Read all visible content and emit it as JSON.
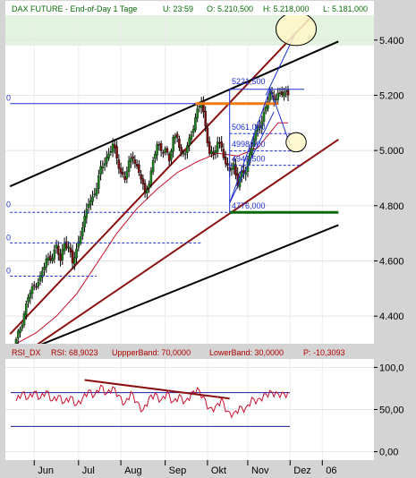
{
  "colors": {
    "frame": "#c8c8c8",
    "pane_bg": "#ffffff",
    "band": "#e2f4df",
    "candle_up": "#1a7f1a",
    "candle_down": "#7a0e0e",
    "wick": "#000000",
    "channel_red": "#8b1010",
    "channel_black": "#000000",
    "ma_red": "#c8102e",
    "blue": "#1f2fd0",
    "orange": "#f07a10",
    "green": "#0a6b0a",
    "ellipse_fill": "#fff7c8",
    "rsi_line": "#c8102e",
    "rsi_band": "#1a1aa0",
    "header_text": "#0a6b0a",
    "rsi_text": "#b00000"
  },
  "header": {
    "symbol": "DAX FUTURE - End-of-Day 1 Tage",
    "u": "U: 23:59",
    "o": "O: 5.210,500",
    "h": "H: 5.218,000",
    "l": "L: 5.181,000"
  },
  "rsi_header": {
    "name": "RSI_DX",
    "rsi": "RSI: 68,9023",
    "upper": "UppperBand: 70,0000",
    "lower": "LowerBand: 30,0000",
    "p": "P: -10,3093"
  },
  "left_marks": [
    {
      "value": 5170,
      "text": "0"
    },
    {
      "value": 4785,
      "text": "0"
    },
    {
      "value": 4665,
      "text": "0"
    },
    {
      "value": 4545,
      "text": "0"
    }
  ],
  "chart_data": {
    "type": "candlestick",
    "price_axis": {
      "min": 4300,
      "max": 5490,
      "ticks": [
        4400,
        4600,
        4800,
        5000,
        5200,
        5400
      ],
      "tick_labels": [
        "4.400",
        "4.600",
        "4.800",
        "5.000",
        "5.200",
        "5.400"
      ]
    },
    "x_axis": {
      "index_range": [
        0,
        135
      ],
      "months": [
        {
          "label": "Jun",
          "index": 9
        },
        {
          "label": "Jul",
          "index": 31
        },
        {
          "label": "Aug",
          "index": 52
        },
        {
          "label": "Sep",
          "index": 74
        },
        {
          "label": "Okt",
          "index": 95
        },
        {
          "label": "Nov",
          "index": 115
        },
        {
          "label": "Dez",
          "index": 136
        },
        {
          "label": "06",
          "index": 152
        }
      ]
    },
    "price_anchors": [
      [
        0,
        4310
      ],
      [
        3,
        4380
      ],
      [
        6,
        4470
      ],
      [
        9,
        4510
      ],
      [
        12,
        4540
      ],
      [
        15,
        4600
      ],
      [
        18,
        4620
      ],
      [
        20,
        4650
      ],
      [
        22,
        4600
      ],
      [
        24,
        4670
      ],
      [
        26,
        4650
      ],
      [
        28,
        4590
      ],
      [
        30,
        4640
      ],
      [
        32,
        4700
      ],
      [
        34,
        4750
      ],
      [
        36,
        4810
      ],
      [
        38,
        4830
      ],
      [
        40,
        4870
      ],
      [
        42,
        4930
      ],
      [
        44,
        4960
      ],
      [
        46,
        4990
      ],
      [
        48,
        5020
      ],
      [
        50,
        4970
      ],
      [
        52,
        4920
      ],
      [
        54,
        4900
      ],
      [
        56,
        4950
      ],
      [
        58,
        4980
      ],
      [
        60,
        4940
      ],
      [
        62,
        4900
      ],
      [
        64,
        4840
      ],
      [
        66,
        4890
      ],
      [
        68,
        4960
      ],
      [
        70,
        5020
      ],
      [
        72,
        5000
      ],
      [
        74,
        5010
      ],
      [
        76,
        4960
      ],
      [
        78,
        5040
      ],
      [
        80,
        5060
      ],
      [
        82,
        4980
      ],
      [
        84,
        4990
      ],
      [
        86,
        5040
      ],
      [
        88,
        5090
      ],
      [
        90,
        5140
      ],
      [
        92,
        5180
      ],
      [
        94,
        5090
      ],
      [
        96,
        4990
      ],
      [
        98,
        4980
      ],
      [
        100,
        5030
      ],
      [
        102,
        5020
      ],
      [
        104,
        4940
      ],
      [
        106,
        4930
      ],
      [
        108,
        4950
      ],
      [
        110,
        4880
      ],
      [
        112,
        4910
      ],
      [
        114,
        4930
      ],
      [
        116,
        4990
      ],
      [
        118,
        5040
      ],
      [
        120,
        5080
      ],
      [
        122,
        5110
      ],
      [
        124,
        5160
      ],
      [
        126,
        5200
      ],
      [
        128,
        5190
      ],
      [
        130,
        5205
      ]
    ],
    "sma_anchors": [
      [
        0,
        4300
      ],
      [
        10,
        4340
      ],
      [
        20,
        4400
      ],
      [
        30,
        4480
      ],
      [
        40,
        4590
      ],
      [
        50,
        4700
      ],
      [
        60,
        4790
      ],
      [
        70,
        4860
      ],
      [
        80,
        4920
      ],
      [
        90,
        4960
      ],
      [
        100,
        4990
      ],
      [
        110,
        4980
      ],
      [
        120,
        5010
      ],
      [
        130,
        5100
      ]
    ],
    "channel_lines": [
      {
        "name": "upper-red",
        "color": "channel_red",
        "from": [
          -3,
          4335
        ],
        "to": [
          146,
          5480
        ]
      },
      {
        "name": "lower-red",
        "color": "channel_red",
        "from": [
          2,
          4255
        ],
        "to": [
          160,
          5040
        ]
      },
      {
        "name": "upper-black",
        "color": "channel_black",
        "from": [
          -3,
          4870
        ],
        "to": [
          160,
          5395
        ]
      },
      {
        "name": "lower-black",
        "color": "channel_black",
        "from": [
          10,
          4290
        ],
        "to": [
          160,
          4730
        ]
      }
    ],
    "horizontal_lines": [
      {
        "name": "hline-5170",
        "value": 5170,
        "from": -3,
        "to": 128,
        "color": "blue",
        "dash": false
      },
      {
        "name": "hline-5221",
        "value": 5221.5,
        "from": 106,
        "to": 143,
        "color": "blue",
        "dash": false
      },
      {
        "name": "hline-4776",
        "value": 4776,
        "from": -3,
        "to": 106,
        "color": "blue",
        "dash": true
      },
      {
        "name": "hline-4665",
        "value": 4665,
        "from": -3,
        "to": 92,
        "color": "blue",
        "dash": true
      },
      {
        "name": "hline-4545",
        "value": 4545,
        "from": -3,
        "to": 40,
        "color": "blue",
        "dash": true
      },
      {
        "name": "fib-5061",
        "value": 5061,
        "from": 106,
        "to": 142,
        "color": "blue",
        "dash": true
      },
      {
        "name": "fib-4998",
        "value": 4998.5,
        "from": 106,
        "to": 142,
        "color": "blue",
        "dash": true
      },
      {
        "name": "fib-4946",
        "value": 4946.5,
        "from": 106,
        "to": 142,
        "color": "blue",
        "dash": true
      },
      {
        "name": "orange-level",
        "value": 5170,
        "from": 89,
        "to": 130,
        "color": "orange",
        "dash": false
      },
      {
        "name": "green-level",
        "value": 4776,
        "from": 106,
        "to": 160,
        "color": "green",
        "dash": false
      }
    ],
    "level_labels": [
      {
        "text": "5221,500",
        "index": 107,
        "value": 5240
      },
      {
        "text": "5061,000",
        "index": 107,
        "value": 5075
      },
      {
        "text": "4998,500",
        "index": 107,
        "value": 5013
      },
      {
        "text": "4946,500",
        "index": 107,
        "value": 4960
      },
      {
        "text": "4776,000",
        "index": 107,
        "value": 4790
      }
    ],
    "vertical_segment": {
      "index": 106,
      "from": 4776,
      "to": 5221.5
    },
    "forecast_lines": [
      {
        "name": "forecast-up",
        "points": [
          [
            124,
            5200
          ],
          [
            139,
            5430
          ]
        ]
      },
      {
        "name": "forecast-down",
        "points": [
          [
            126,
            5225
          ],
          [
            136,
            5020
          ]
        ]
      },
      {
        "name": "forecast-wedge-a",
        "points": [
          [
            106,
            4810
          ],
          [
            126,
            5220
          ]
        ]
      },
      {
        "name": "forecast-wedge-b",
        "points": [
          [
            106,
            4810
          ],
          [
            128,
            5140
          ]
        ]
      }
    ],
    "target_zones": [
      {
        "name": "target-ellipse-upper",
        "center": [
          139,
          5440
        ],
        "rx_days": 10,
        "ry_value": 60
      },
      {
        "name": "target-ellipse-lower",
        "center": [
          139,
          5030
        ],
        "rx_days": 5,
        "ry_value": 35
      }
    ],
    "band_zone": {
      "from": 5380,
      "to": 5490
    },
    "rsi": {
      "axis": {
        "min": -10,
        "max": 110,
        "ticks": [
          0,
          50,
          100
        ],
        "tick_labels": [
          "0,00",
          "50,00",
          "100,0"
        ]
      },
      "upper_band": 70,
      "lower_band": 30,
      "anchors": [
        [
          0,
          60
        ],
        [
          3,
          70
        ],
        [
          6,
          63
        ],
        [
          9,
          71
        ],
        [
          12,
          63
        ],
        [
          15,
          72
        ],
        [
          18,
          60
        ],
        [
          21,
          66
        ],
        [
          24,
          58
        ],
        [
          27,
          65
        ],
        [
          30,
          55
        ],
        [
          33,
          63
        ],
        [
          36,
          72
        ],
        [
          39,
          66
        ],
        [
          42,
          78
        ],
        [
          45,
          68
        ],
        [
          48,
          76
        ],
        [
          51,
          66
        ],
        [
          54,
          56
        ],
        [
          57,
          70
        ],
        [
          60,
          58
        ],
        [
          63,
          48
        ],
        [
          66,
          63
        ],
        [
          69,
          68
        ],
        [
          72,
          60
        ],
        [
          75,
          70
        ],
        [
          78,
          58
        ],
        [
          81,
          66
        ],
        [
          84,
          58
        ],
        [
          87,
          68
        ],
        [
          90,
          74
        ],
        [
          93,
          64
        ],
        [
          96,
          50
        ],
        [
          99,
          52
        ],
        [
          102,
          62
        ],
        [
          105,
          46
        ],
        [
          108,
          44
        ],
        [
          111,
          52
        ],
        [
          114,
          50
        ],
        [
          117,
          62
        ],
        [
          120,
          60
        ],
        [
          123,
          66
        ],
        [
          126,
          70
        ],
        [
          130,
          68
        ]
      ],
      "trendline": {
        "from": [
          34,
          85
        ],
        "to": [
          106,
          63
        ]
      }
    }
  }
}
